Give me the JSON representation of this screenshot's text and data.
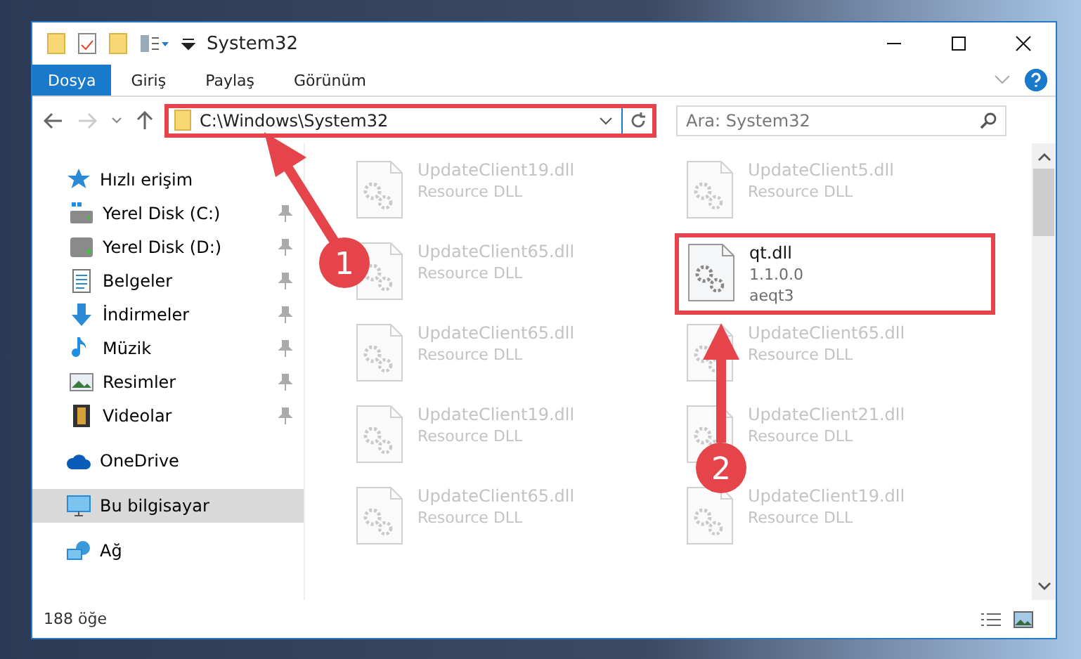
{
  "window": {
    "title": "System32"
  },
  "ribbon_tabs": [
    {
      "label": "Dosya",
      "selected": true
    },
    {
      "label": "Giriş",
      "selected": false
    },
    {
      "label": "Paylaş",
      "selected": false
    },
    {
      "label": "Görünüm",
      "selected": false
    }
  ],
  "address_bar": {
    "path": "C:\\Windows\\System32",
    "highlighted": true
  },
  "search": {
    "placeholder": "Ara: System32"
  },
  "sidebar": {
    "items": [
      {
        "label": "Hızlı erişim",
        "kind": "star",
        "selected": false,
        "children": [
          {
            "label": "Yerel Disk (C:)",
            "kind": "disk-c",
            "pinned": true,
            "selected": false
          },
          {
            "label": "Yerel Disk (D:)",
            "kind": "disk",
            "pinned": true,
            "selected": false
          },
          {
            "label": "Belgeler",
            "kind": "docs",
            "pinned": true,
            "selected": false
          },
          {
            "label": "İndirmeler",
            "kind": "download",
            "pinned": true,
            "selected": false
          },
          {
            "label": "Müzik",
            "kind": "music",
            "pinned": true,
            "selected": false
          },
          {
            "label": "Resimler",
            "kind": "pictures",
            "pinned": true,
            "selected": false
          },
          {
            "label": "Videolar",
            "kind": "videos",
            "pinned": true,
            "selected": false
          }
        ]
      },
      {
        "label": "OneDrive",
        "kind": "cloud",
        "selected": false
      },
      {
        "label": "Bu bilgisayar",
        "kind": "pc",
        "selected": true
      },
      {
        "label": "Ağ",
        "kind": "network",
        "selected": false
      }
    ]
  },
  "files": [
    {
      "name": "UpdateClient19.dll",
      "lines": [
        "Resource DLL"
      ],
      "highlighted": false
    },
    {
      "name": "UpdateClient5.dll",
      "lines": [
        "Resource DLL"
      ],
      "highlighted": false
    },
    {
      "name": "UpdateClient65.dll",
      "lines": [
        "Resource DLL"
      ],
      "highlighted": false
    },
    {
      "name": "qt.dll",
      "lines": [
        "1.1.0.0",
        "aeqt3"
      ],
      "highlighted": true
    },
    {
      "name": "UpdateClient65.dll",
      "lines": [
        "Resource DLL"
      ],
      "highlighted": false
    },
    {
      "name": "UpdateClient65.dll",
      "lines": [
        "Resource DLL"
      ],
      "highlighted": false
    },
    {
      "name": "UpdateClient19.dll",
      "lines": [
        "Resource DLL"
      ],
      "highlighted": false
    },
    {
      "name": "UpdateClient21.dll",
      "lines": [
        "Resource DLL"
      ],
      "highlighted": false
    },
    {
      "name": "UpdateClient65.dll",
      "lines": [
        "Resource DLL"
      ],
      "highlighted": false
    },
    {
      "name": "UpdateClient19.dll",
      "lines": [
        "Resource DLL"
      ],
      "highlighted": false
    }
  ],
  "status_bar": {
    "count": "188 öğe"
  },
  "annotations": [
    {
      "label": "1"
    },
    {
      "label": "2"
    }
  ]
}
